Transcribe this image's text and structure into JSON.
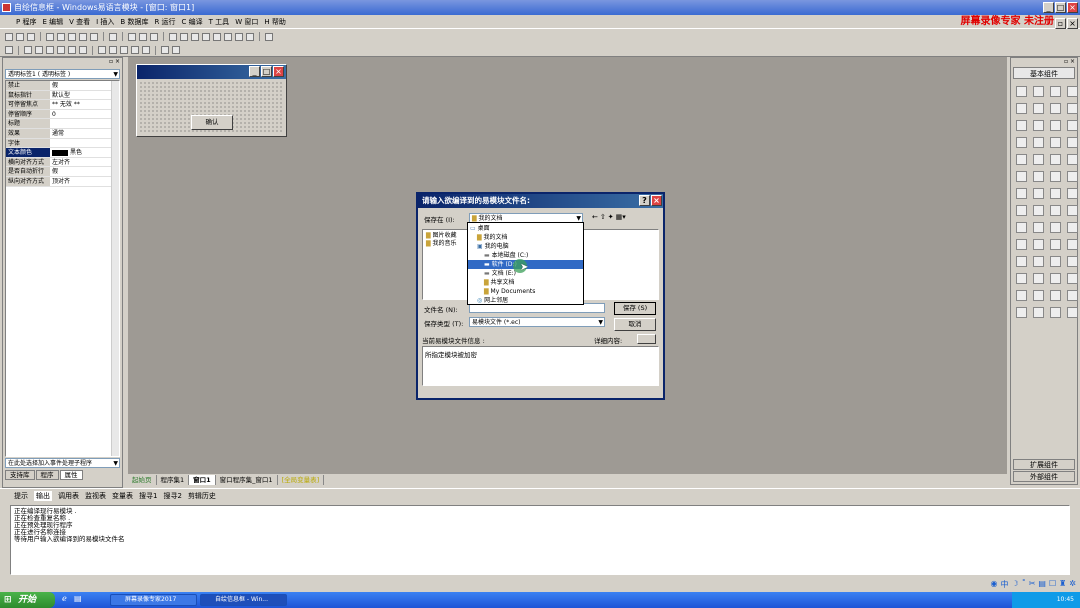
{
  "window": {
    "title": "自绘信息框 - Windows易语言模块 - [窗口: 窗口1]"
  },
  "menu": {
    "items": [
      "P 程序",
      "E 编辑",
      "V 查看",
      "I 插入",
      "B 数据库",
      "R 运行",
      "C 编译",
      "T 工具",
      "W 窗口",
      "H 帮助"
    ],
    "promo": "屏幕录像专家  未注册"
  },
  "left_panel": {
    "dropdown": "透明标签1 ( 透明标签 )",
    "properties": [
      {
        "k": "禁止",
        "v": "假"
      },
      {
        "k": "鼠标指针",
        "v": "默认型"
      },
      {
        "k": "可停留焦点",
        "v": "** 无效 **"
      },
      {
        "k": "停留顺序",
        "v": "0"
      },
      {
        "k": "标题",
        "v": ""
      },
      {
        "k": "效果",
        "v": "通常"
      },
      {
        "k": "字体",
        "v": ""
      },
      {
        "k": "文本颜色",
        "v": "黑色"
      },
      {
        "k": "横向对齐方式",
        "v": "左对齐"
      },
      {
        "k": "是否自动折行",
        "v": "假"
      },
      {
        "k": "纵向对齐方式",
        "v": "顶对齐"
      }
    ],
    "event_combo": "在此处选择加入事件处理子程序",
    "tabs": [
      "支持库",
      "程序",
      "属性"
    ]
  },
  "form": {
    "button_label": "确认"
  },
  "right_panel": {
    "header": "基本组件",
    "footer_tabs": [
      "扩展组件",
      "外部组件"
    ],
    "icon_count": 56
  },
  "editor_tabs": [
    "起始页",
    "程序集1",
    "窗口1",
    "窗口程序集_窗口1",
    "[全局变量表]"
  ],
  "bottom_tabs": [
    "提示",
    "输出",
    "调用表",
    "监视表",
    "变量表",
    "搜寻1",
    "搜寻2",
    "剪辑历史"
  ],
  "output": {
    "lines": [
      "正在编译现行易模块 .",
      "正在检查重复名称 .",
      "正在预处理现行程序",
      "正在进行名称连接",
      "等待用户输入欲编译到的易模块文件名"
    ]
  },
  "dialog": {
    "title": "请输入欲编译到的易模块文件名:",
    "save_in_label": "保存在 (I):",
    "save_in_value": "我的文档",
    "file_list": [
      "图片收藏",
      "我的音乐"
    ],
    "dropdown_items": [
      {
        "label": "桌面",
        "level": 0,
        "icon": "desktop"
      },
      {
        "label": "我的文档",
        "level": 1,
        "icon": "folder"
      },
      {
        "label": "我的电脑",
        "level": 1,
        "icon": "computer"
      },
      {
        "label": "本地磁盘 (C:)",
        "level": 2,
        "icon": "drive"
      },
      {
        "label": "软件 (D:)",
        "level": 2,
        "icon": "drive",
        "selected": true
      },
      {
        "label": "文档 (E:)",
        "level": 2,
        "icon": "drive"
      },
      {
        "label": "共享文档",
        "level": 2,
        "icon": "folder"
      },
      {
        "label": "My Documents",
        "level": 2,
        "icon": "folder"
      },
      {
        "label": "网上邻居",
        "level": 1,
        "icon": "network"
      }
    ],
    "filename_label": "文件名 (N):",
    "filetype_label": "保存类型 (T):",
    "filetype_value": "易模块文件 (*.ec)",
    "save_button": "保存 (S)",
    "cancel_button": "取消",
    "info_label": "当前易模块文件信息 :",
    "detail_label": "详细内容:",
    "info_text": "所指定模块被加密"
  },
  "taskbar": {
    "start": "开始",
    "items": [
      "屏幕录像专家2017",
      "自绘信息框 - Win..."
    ],
    "clock": "10:45"
  },
  "colors": {
    "titlebar": "#3a6ad2",
    "dialog_title": "#0a246a",
    "promo": "#e00000",
    "workspace": "#9e9a94"
  }
}
